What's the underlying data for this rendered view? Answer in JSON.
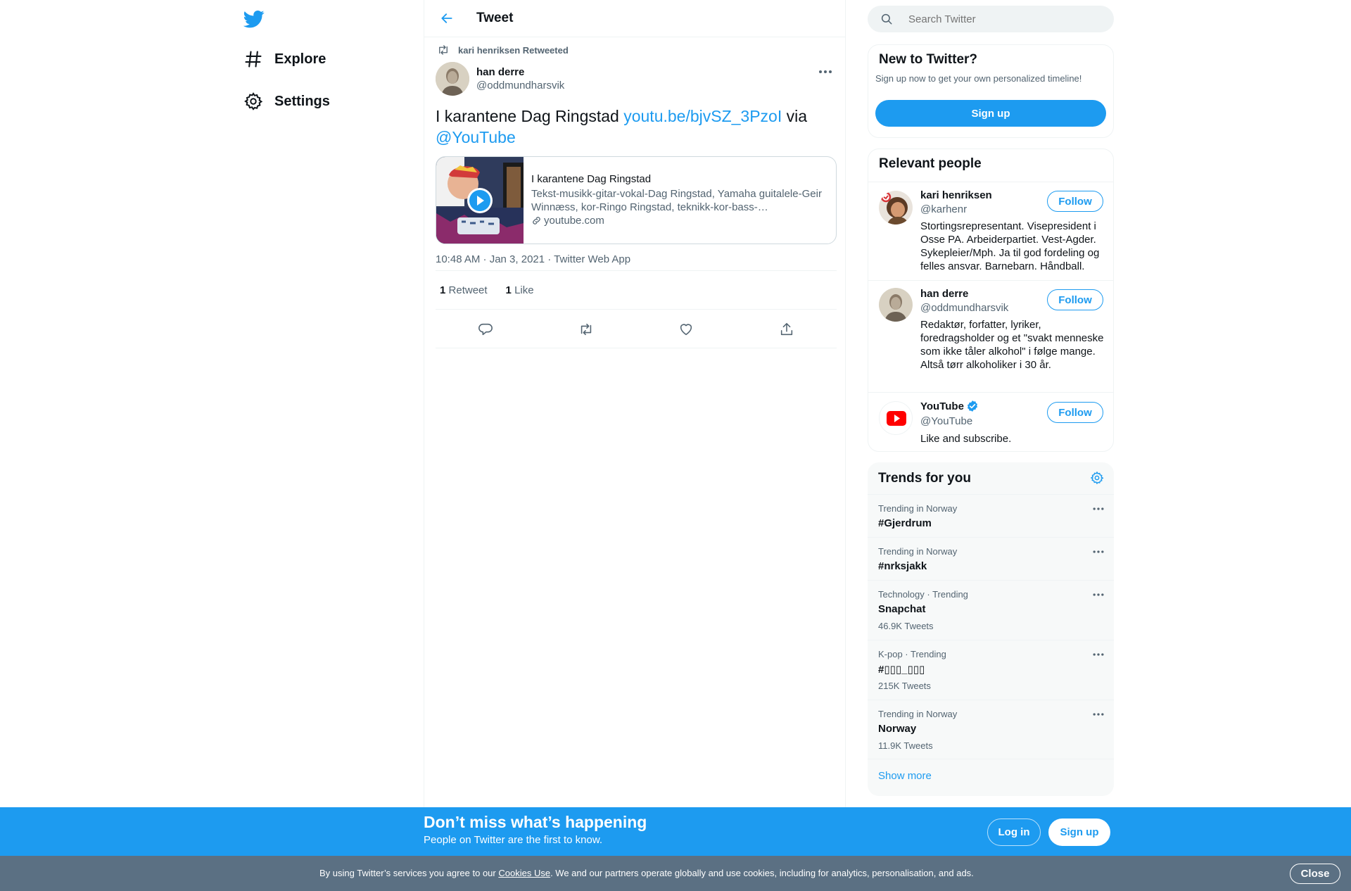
{
  "nav": {
    "explore": "Explore",
    "settings": "Settings"
  },
  "header": {
    "title": "Tweet"
  },
  "tweet": {
    "retweeted_by": "kari henriksen Retweeted",
    "author_name": "han derre",
    "author_handle": "@oddmundharsvik",
    "text_prefix": "I karantene  Dag Ringstad ",
    "text_link": "youtu.be/bjvSZ_3PzoI",
    "text_via": " via ",
    "text_mention": "@YouTube",
    "card": {
      "title": "I karantene Dag Ringstad",
      "description": "Tekst-musikk-gitar-vokal-Dag Ringstad, Yamaha guitalele-Geir Winnæss, kor-Ringo Ringstad, teknikk-kor-bass-…",
      "domain": "youtube.com"
    },
    "meta": "10:48 AM · Jan 3, 2021 · Twitter Web App",
    "retweet_count": "1",
    "retweet_label": "Retweet",
    "like_count": "1",
    "like_label": "Like"
  },
  "search": {
    "placeholder": "Search Twitter"
  },
  "new_to_twitter": {
    "title": "New to Twitter?",
    "subtitle": "Sign up now to get your own personalized timeline!",
    "signup": "Sign up"
  },
  "relevant": {
    "title": "Relevant people",
    "follow_label": "Follow",
    "people": [
      {
        "name": "kari henriksen",
        "handle": "@karhenr",
        "bio": "Stortingsrepresentant. Visepresident i Osse PA. Arbeiderpartiet. Vest-Agder. Sykepleier/Mph. Ja til god fordeling og felles ansvar. Barnebarn. Håndball."
      },
      {
        "name": "han derre",
        "handle": "@oddmundharsvik",
        "bio": "Redaktør, forfatter, lyriker, foredragsholder og et \"svakt menneske som ikke tåler alkohol\" i følge mange. Altså tørr alkoholiker i 30 år."
      },
      {
        "name": "YouTube",
        "handle": "@YouTube",
        "bio": "Like and subscribe."
      }
    ]
  },
  "trends": {
    "title": "Trends for you",
    "items": [
      {
        "context": "Trending in Norway",
        "name": "#Gjerdrum",
        "count": ""
      },
      {
        "context": "Trending in Norway",
        "name": "#nrksjakk",
        "count": ""
      },
      {
        "context": "Technology · Trending",
        "name": "Snapchat",
        "count": "46.9K Tweets"
      },
      {
        "context": "K-pop · Trending",
        "name": "#▯▯▯_▯▯▯",
        "count": "215K Tweets"
      },
      {
        "context": "Trending in Norway",
        "name": "Norway",
        "count": "11.9K Tweets"
      }
    ],
    "show_more": "Show more"
  },
  "banner": {
    "headline": "Don’t miss what’s happening",
    "sub": "People on Twitter are the first to know.",
    "login": "Log in",
    "signup": "Sign up"
  },
  "cookie": {
    "prefix": "By using Twitter’s services you agree to our ",
    "link": "Cookies Use",
    "suffix": ". We and our partners operate globally and use cookies, including for analytics, personalisation, and ads.",
    "close": "Close"
  },
  "colors": {
    "accent": "#1d9bf0",
    "banner": "#1d9bf0",
    "cookie_bar": "#5b7083"
  }
}
